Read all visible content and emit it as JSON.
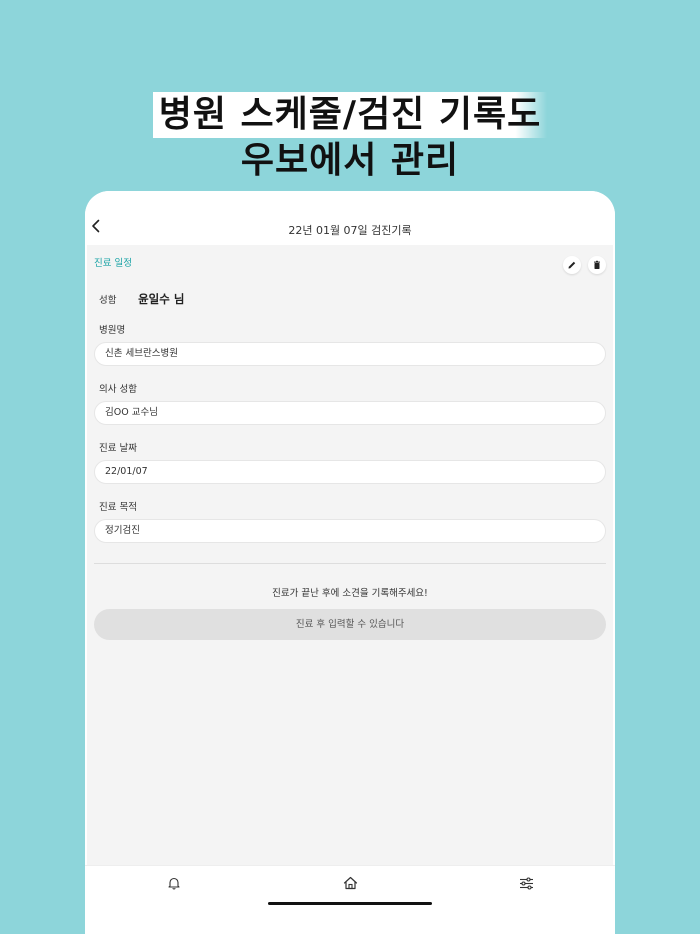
{
  "headline": {
    "line1": "병원 스케줄/검진 기록도",
    "line2": "우보에서 관리"
  },
  "topbar": {
    "back_icon": "chevron-left-icon",
    "title": "22년 01월 07일 검진기록"
  },
  "schedule": {
    "section_label": "진료 일정",
    "edit_icon": "pencil-icon",
    "delete_icon": "trash-icon",
    "name_label": "성함",
    "name_value": "윤일수 님",
    "fields": [
      {
        "label": "병원명",
        "value": "신촌 세브란스병원"
      },
      {
        "label": "의사 성함",
        "value": "김OO 교수님"
      },
      {
        "label": "진료 날짜",
        "value": "22/01/07"
      },
      {
        "label": "진료 목적",
        "value": "정기검진"
      }
    ],
    "notice": "진료가 끝난 후에 소견을 기록해주세요!",
    "record_button": "진료 후 입력할 수 있습니다"
  },
  "tabbar": {
    "items": [
      {
        "icon": "bell-icon"
      },
      {
        "icon": "home-icon"
      },
      {
        "icon": "sliders-icon"
      }
    ]
  },
  "colors": {
    "background": "#8dd5da",
    "accent": "#1aa3a6",
    "panel": "#f4f4f4"
  }
}
